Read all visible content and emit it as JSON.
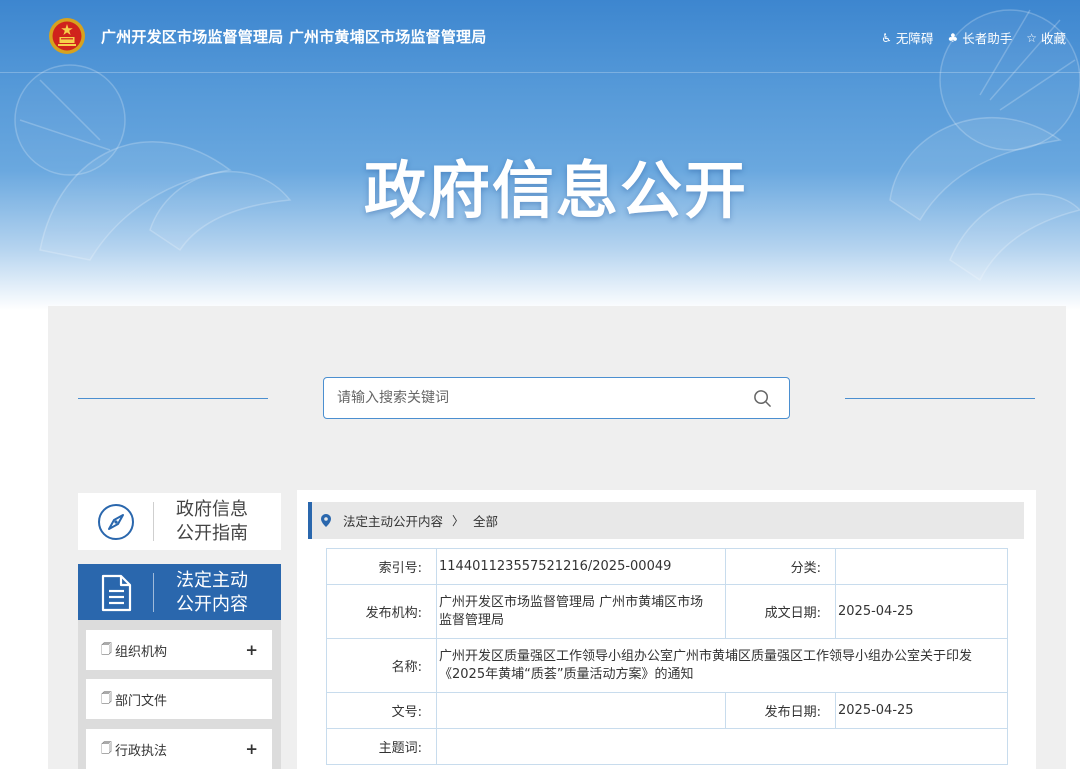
{
  "header": {
    "site_name": "广州开发区市场监督管理局 广州市黄埔区市场监督管理局",
    "links": [
      {
        "icon": "accessibility-icon",
        "label": "无障碍"
      },
      {
        "icon": "elderly-assistant-icon",
        "label": "长者助手"
      },
      {
        "icon": "star-icon",
        "label": "收藏"
      }
    ]
  },
  "banner": {
    "title": "政府信息公开"
  },
  "search": {
    "placeholder": "请输入搜索关键词"
  },
  "sidebar": {
    "guide_label_1": "政府信息",
    "guide_label_2": "公开指南",
    "legal_label_1": "法定主动",
    "legal_label_2": "公开内容",
    "items": [
      {
        "label": "组织机构",
        "expandable": "+"
      },
      {
        "label": "部门文件",
        "expandable": ""
      },
      {
        "label": "行政执法",
        "expandable": "+"
      }
    ]
  },
  "breadcrumb": {
    "parent": "法定主动公开内容",
    "current": "全部"
  },
  "detail": {
    "index_label": "索引号:",
    "index_value": "114401123557521216/2025-00049",
    "category_label": "分类:",
    "category_value": "",
    "publisher_label": "发布机构:",
    "publisher_value": "广州开发区市场监督管理局 广州市黄埔区市场监督管理局",
    "created_label": "成文日期:",
    "created_value": "2025-04-25",
    "name_label": "名称:",
    "name_value": "广州开发区质量强区工作领导小组办公室广州市黄埔区质量强区工作领导小组办公室关于印发《2025年黄埔“质荟”质量活动方案》的通知",
    "docno_label": "文号:",
    "docno_value": "",
    "published_label": "发布日期:",
    "published_value": "2025-04-25",
    "subject_label": "主题词:",
    "subject_value": ""
  },
  "colors": {
    "primary_blue": "#2a67ad",
    "banner_blue": "#3d86cf",
    "table_border": "#c8dced"
  }
}
